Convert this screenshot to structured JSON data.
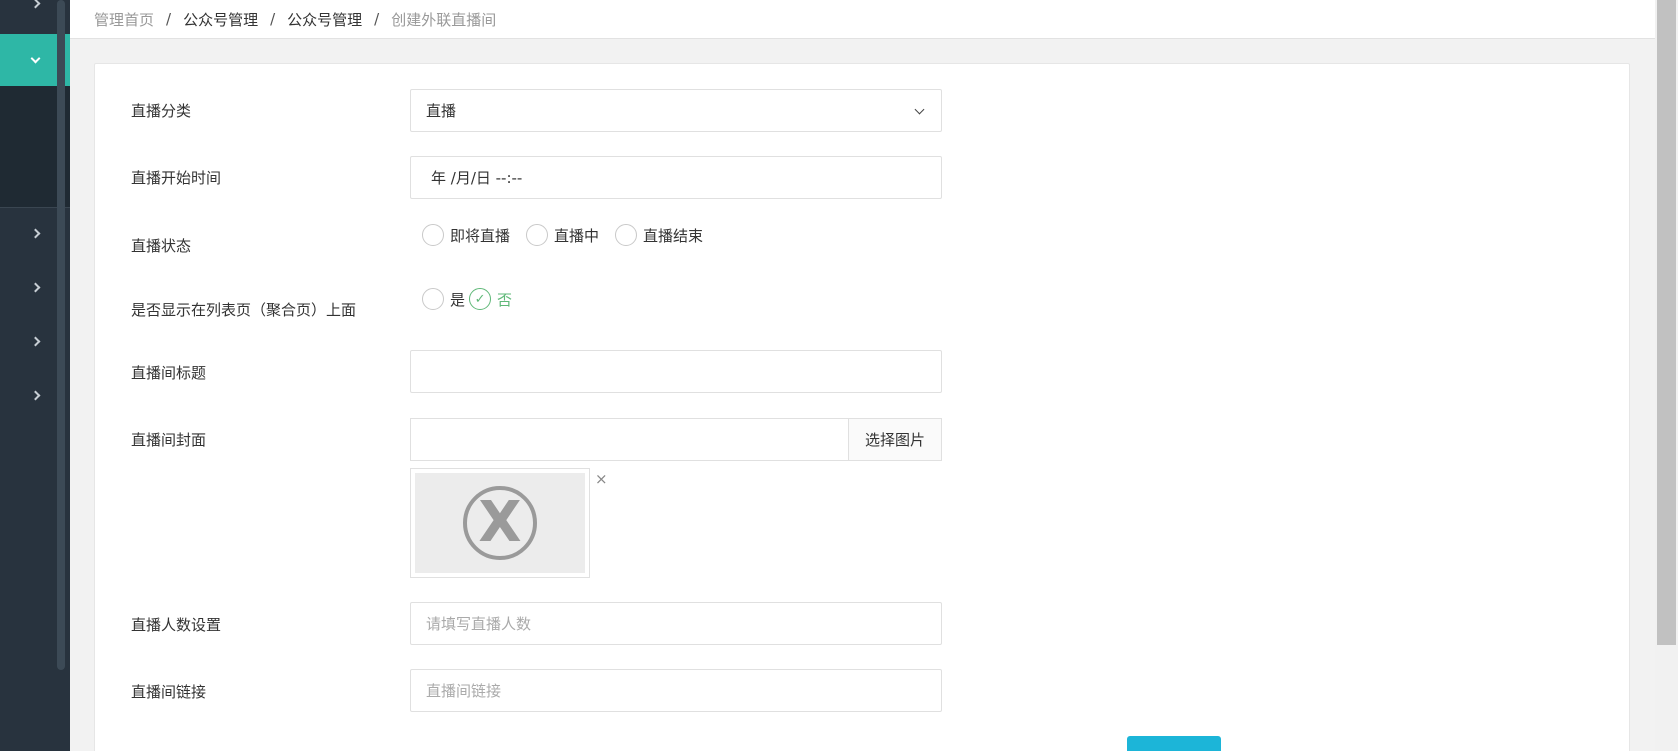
{
  "breadcrumb": {
    "items": [
      "管理首页",
      "公众号管理",
      "公众号管理",
      "创建外联直播间"
    ],
    "separator": "/"
  },
  "colors": {
    "sidebar_bg": "#28333e",
    "sidebar_active": "#2eb7a6",
    "radio_checked": "#5fb878",
    "primary_button": "#1cb5d8"
  },
  "form": {
    "category": {
      "label": "直播分类",
      "value": "直播"
    },
    "start_time": {
      "label": "直播开始时间",
      "value": "年 /月/日 --:--"
    },
    "status": {
      "label": "直播状态",
      "options": [
        "即将直播",
        "直播中",
        "直播结束"
      ],
      "selected": null
    },
    "show_on_list": {
      "label": "是否显示在列表页（聚合页）上面",
      "options": [
        "是",
        "否"
      ],
      "selected": "否"
    },
    "title": {
      "label": "直播间标题",
      "value": ""
    },
    "cover": {
      "label": "直播间封面",
      "value": "",
      "choose_button": "选择图片",
      "remove_glyph": "×",
      "broken_image_glyph": "X"
    },
    "viewer_count": {
      "label": "直播人数设置",
      "placeholder": "请填写直播人数"
    },
    "link": {
      "label": "直播间链接",
      "placeholder": "直播间链接"
    }
  },
  "icons": {
    "sidebar": [
      "chevron-right-icon",
      "chevron-down-icon",
      "chevron-right-icon",
      "chevron-right-icon",
      "chevron-right-icon",
      "chevron-right-icon"
    ],
    "select": "chevron-down-icon",
    "radio_check": "check-icon"
  },
  "radio_check_glyph": "✓"
}
